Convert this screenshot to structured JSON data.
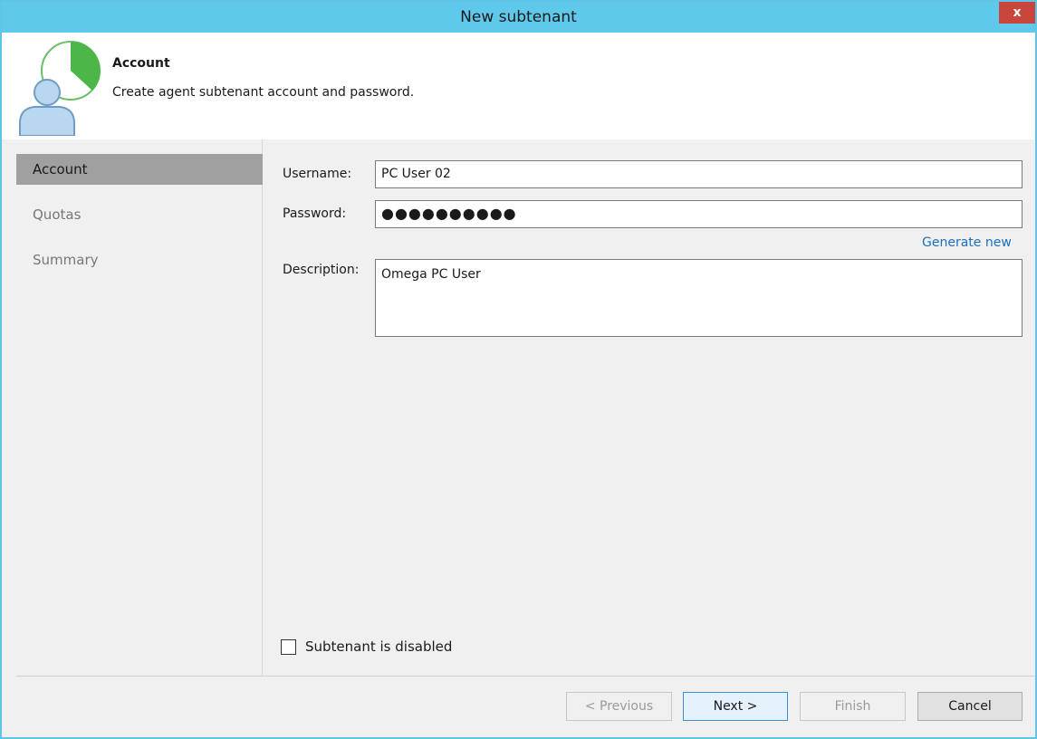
{
  "window": {
    "title": "New subtenant",
    "close_label": "x"
  },
  "header": {
    "title": "Account",
    "subtitle": "Create agent subtenant account and password.",
    "icon": "user-account-icon"
  },
  "nav": {
    "items": [
      {
        "label": "Account",
        "active": true
      },
      {
        "label": "Quotas",
        "active": false
      },
      {
        "label": "Summary",
        "active": false
      }
    ]
  },
  "form": {
    "username_label": "Username:",
    "username_value": "PC User 02",
    "password_label": "Password:",
    "password_value": "●●●●●●●●●●",
    "generate_link": "Generate new",
    "description_label": "Description:",
    "description_value": "Omega PC User",
    "disabled_checkbox_label": "Subtenant is disabled",
    "disabled_checked": false
  },
  "buttons": {
    "previous": "< Previous",
    "next": "Next >",
    "finish": "Finish",
    "cancel": "Cancel"
  },
  "colors": {
    "titlebar": "#5fc9ec",
    "close": "#c9463d",
    "nav_active": "#a0a0a0",
    "link": "#1d6fb8"
  }
}
